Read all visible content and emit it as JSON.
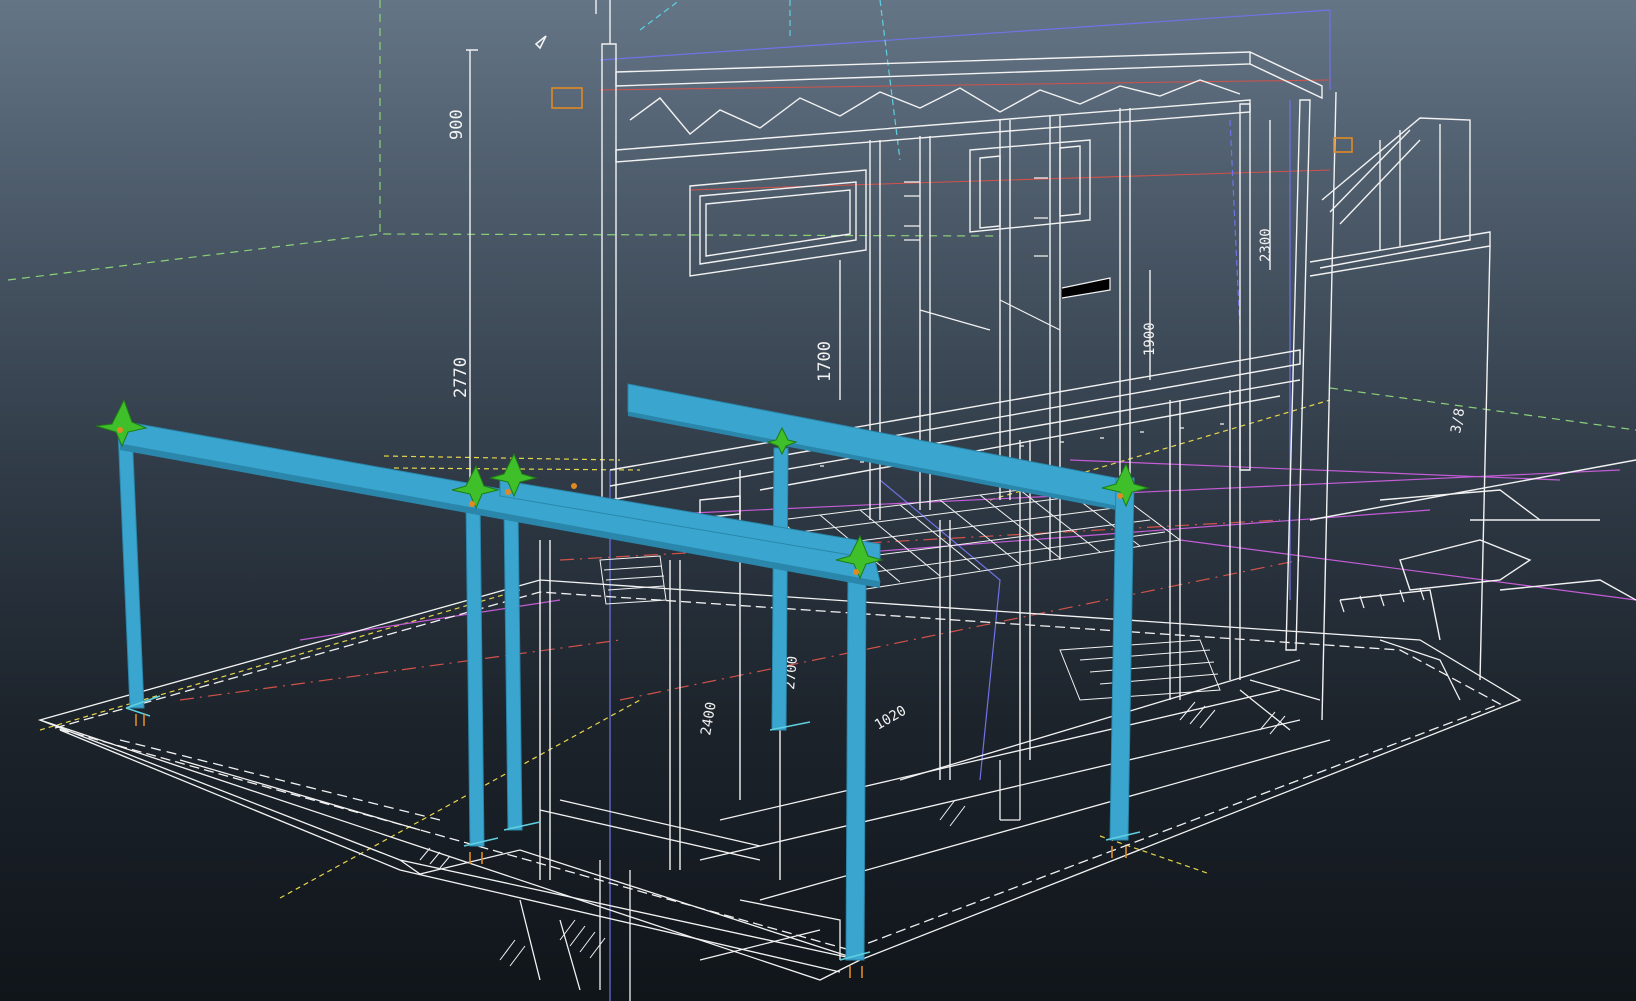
{
  "viewport": {
    "dimensions": [
      "900",
      "2770",
      "1700",
      "2300",
      "1900",
      "2400",
      "2700",
      "1020",
      "3/8"
    ]
  },
  "colors": {
    "beam": "#3aa6cf",
    "beam_edge": "#2a86aa",
    "grip": "#3fbf2a",
    "wire": "#f2f2f2",
    "guide_green": "#8bd17a",
    "guide_yellow": "#e6d64a",
    "guide_red": "#d2524a",
    "guide_magenta": "#c35cd6",
    "guide_blue": "#6f73e6",
    "marker_orange": "#e08a24"
  },
  "icons": [
    "grip-arrow-icon",
    "view-marker-icon",
    "column-base-icon"
  ]
}
